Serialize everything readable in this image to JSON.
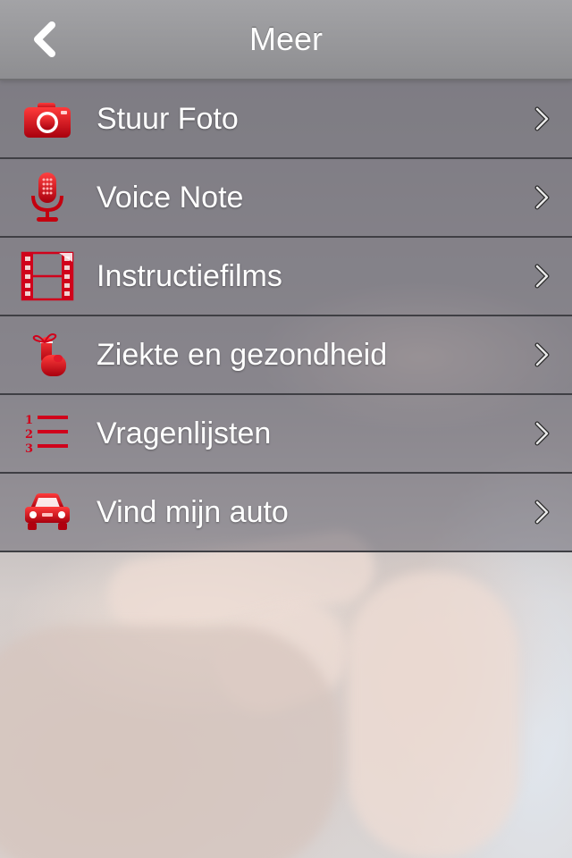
{
  "header": {
    "title": "Meer",
    "back_icon": "chevron-left-icon"
  },
  "colors": {
    "accent": "#d0021b",
    "header_bg": "#9a9a9d",
    "row_bg": "#6e6c76",
    "text": "#ffffff"
  },
  "menu": {
    "items": [
      {
        "label": "Stuur Foto",
        "icon": "camera-icon"
      },
      {
        "label": "Voice Note",
        "icon": "microphone-icon"
      },
      {
        "label": "Instructiefilms",
        "icon": "film-icon"
      },
      {
        "label": "Ziekte en gezondheid",
        "icon": "finger-string-icon"
      },
      {
        "label": "Vragenlijsten",
        "icon": "numbered-list-icon"
      },
      {
        "label": "Vind mijn auto",
        "icon": "car-icon"
      }
    ],
    "row_chevron_icon": "chevron-right-icon"
  }
}
